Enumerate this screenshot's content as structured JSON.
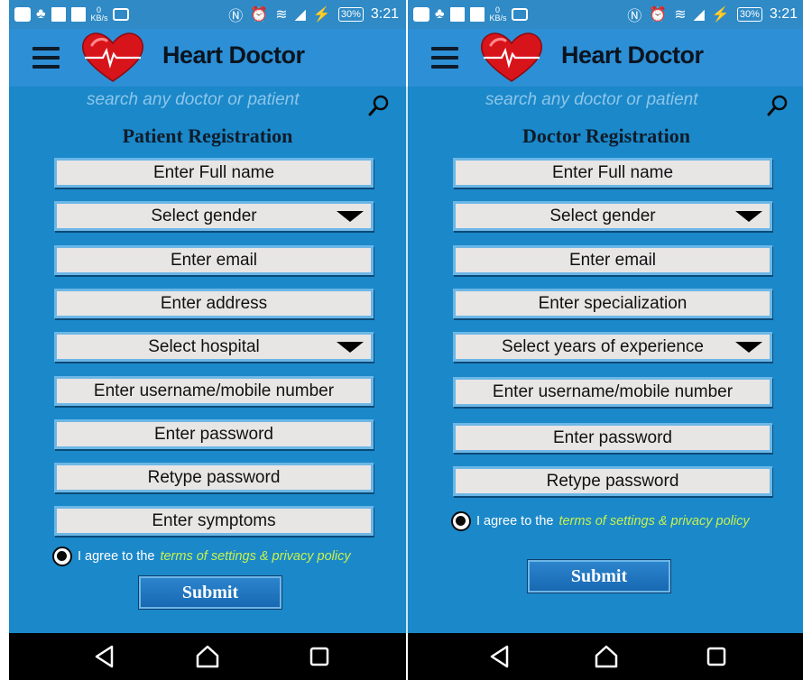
{
  "status_bar": {
    "kb_value": "0",
    "kb_unit": "KB/s",
    "battery": "30%",
    "time": "3:21"
  },
  "app": {
    "title": "Heart Doctor",
    "search_placeholder": "search any doctor or patient"
  },
  "patient_form": {
    "title": "Patient Registration",
    "fields": [
      "Enter Full name",
      "Select gender",
      "Enter email",
      "Enter address",
      "Select hospital",
      "Enter username/mobile number",
      "Enter password",
      "Retype password",
      "Enter symptoms"
    ],
    "agree_prefix": "I agree to the",
    "terms_link": "terms of settings & privacy policy",
    "submit": "Submit"
  },
  "doctor_form": {
    "title": "Doctor Registration",
    "fields": [
      "Enter Full name",
      "Select gender",
      "Enter email",
      "Enter specialization",
      "Select years of experience",
      "Enter username/mobile number",
      "Enter password",
      "Retype password"
    ],
    "agree_prefix": "I agree to the",
    "terms_link": "terms of settings & privacy policy",
    "submit": "Submit"
  },
  "colors": {
    "background": "#1b88c9",
    "app_bar": "#2d8fd5",
    "field": "#e8e5e5",
    "terms_link": "#c6f24e"
  },
  "icons": [
    "menu-icon",
    "heart-logo-icon",
    "search-icon",
    "back-icon",
    "home-icon",
    "recents-icon",
    "radio-checked-icon",
    "dropdown-caret-icon"
  ]
}
